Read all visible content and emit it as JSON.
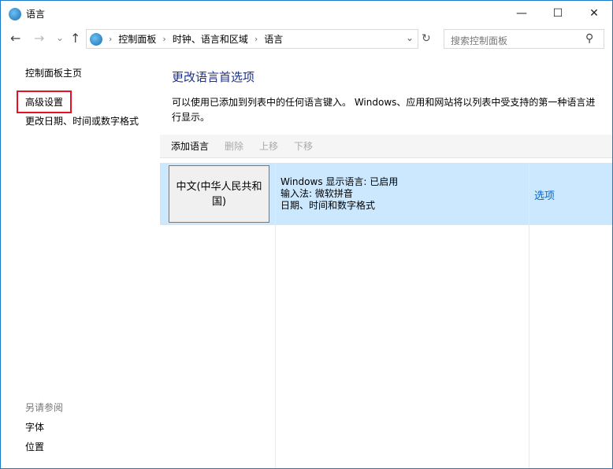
{
  "window": {
    "title": "语言",
    "minimize": "—",
    "maximize": "☐",
    "close": "✕"
  },
  "nav": {
    "back": "←",
    "forward": "→",
    "recent": "⌄",
    "up": "↑",
    "refresh": "↻",
    "dropdown": "⌄"
  },
  "breadcrumb": [
    "控制面板",
    "时钟、语言和区域",
    "语言"
  ],
  "search": {
    "placeholder": "搜索控制面板",
    "icon": "⚲"
  },
  "sidebar": {
    "items": [
      "控制面板主页",
      "高级设置",
      "更改日期、时间或数字格式"
    ],
    "see_also_title": "另请参阅",
    "see_also": [
      "字体",
      "位置"
    ]
  },
  "main": {
    "title": "更改语言首选项",
    "description": "可以使用已添加到列表中的任何语言键入。 Windows、应用和网站将以列表中受支持的第一种语言进行显示。",
    "toolbar": {
      "add": "添加语言",
      "remove": "删除",
      "up": "上移",
      "down": "下移"
    },
    "languages": [
      {
        "name": "中文(中华人民共和国)",
        "lines": [
          "Windows 显示语言: 已启用",
          "输入法: 微软拼音",
          "日期、时间和数字格式"
        ],
        "options": "选项"
      }
    ]
  },
  "colors": {
    "accent": "#0066cc",
    "highlight": "#e81123",
    "selected": "#cce8ff"
  }
}
